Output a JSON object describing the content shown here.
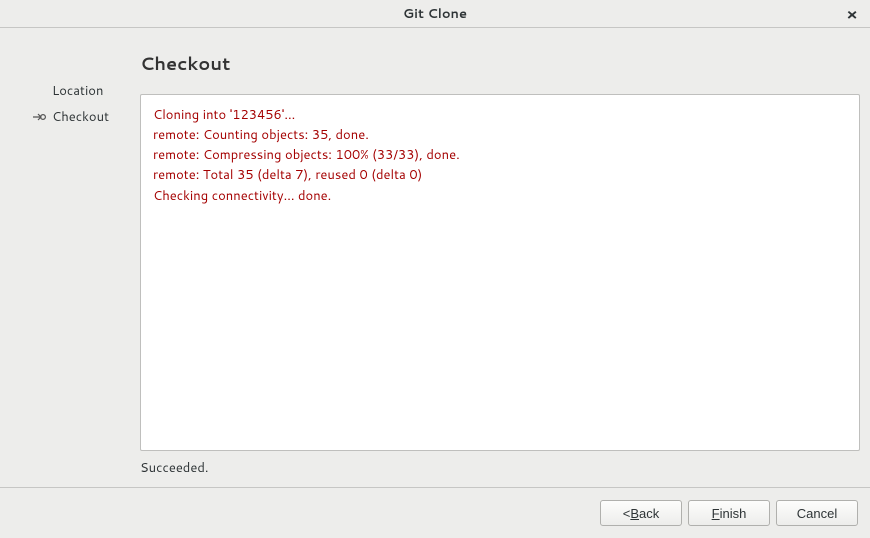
{
  "window": {
    "title": "Git Clone"
  },
  "sidebar": {
    "items": [
      {
        "label": "Location",
        "current": false
      },
      {
        "label": "Checkout",
        "current": true
      }
    ]
  },
  "page": {
    "title": "Checkout",
    "output_lines": [
      "Cloning into '123456'...",
      "remote: Counting objects: 35, done.",
      "remote: Compressing objects: 100% (33/33), done.",
      "remote: Total 35 (delta 7), reused 0 (delta 0)",
      "Checking connectivity... done."
    ],
    "status": "Succeeded."
  },
  "footer": {
    "back_prefix": "< ",
    "back_ul": "B",
    "back_rest": "ack",
    "finish_ul": "F",
    "finish_rest": "inish",
    "cancel": "Cancel"
  }
}
